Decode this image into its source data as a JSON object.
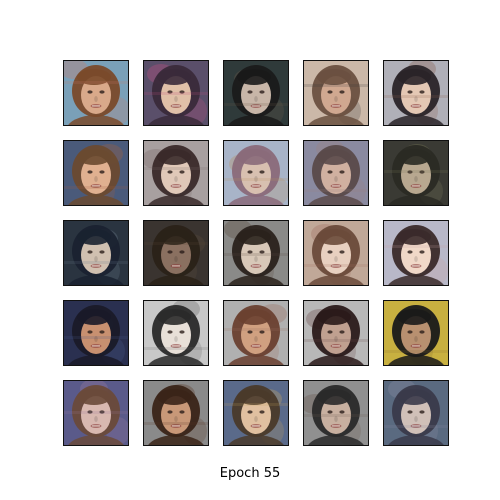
{
  "figure": {
    "caption": "Epoch 55",
    "rows": 5,
    "cols": 5,
    "images": [
      {
        "bg": "#7aa0b8",
        "hair": "#7a4a2a",
        "skin": "#d9a98a",
        "accent": "#c97a6a"
      },
      {
        "bg": "#5a4f6a",
        "hair": "#3a2a3a",
        "skin": "#e0c0a8",
        "accent": "#c05080"
      },
      {
        "bg": "#2f3a3a",
        "hair": "#1a1a1a",
        "skin": "#c8b6a8",
        "accent": "#6a5a4a"
      },
      {
        "bg": "#cbb8a8",
        "hair": "#6a5040",
        "skin": "#d0a890",
        "accent": "#3a3a3a"
      },
      {
        "bg": "#b0b0b8",
        "hair": "#2a2428",
        "skin": "#e4c8b4",
        "accent": "#8a6050"
      },
      {
        "bg": "#4a5a7a",
        "hair": "#6a4a30",
        "skin": "#e0b090",
        "accent": "#a06040"
      },
      {
        "bg": "#a8a0a0",
        "hair": "#3a2a2a",
        "skin": "#e0c8b8",
        "accent": "#7a6a6a"
      },
      {
        "bg": "#a8b4c8",
        "hair": "#8a6a7a",
        "skin": "#d8c0b0",
        "accent": "#b89060"
      },
      {
        "bg": "#8a8aa0",
        "hair": "#5a4a4a",
        "skin": "#d0b0a0",
        "accent": "#9a8080"
      },
      {
        "bg": "#3a3a34",
        "hair": "#2a2a24",
        "skin": "#b8a890",
        "accent": "#7a7a5a"
      },
      {
        "bg": "#2a3440",
        "hair": "#1a2230",
        "skin": "#d0c0b0",
        "accent": "#6a7a8a"
      },
      {
        "bg": "#3a3430",
        "hair": "#2a2218",
        "skin": "#8a7060",
        "accent": "#5a4a3a"
      },
      {
        "bg": "#8a8a88",
        "hair": "#2a221c",
        "skin": "#d8c8b8",
        "accent": "#5a4a40"
      },
      {
        "bg": "#c0a898",
        "hair": "#6a4a3a",
        "skin": "#e8d0c0",
        "accent": "#a07060"
      },
      {
        "bg": "#b8b8c8",
        "hair": "#3a2a2a",
        "skin": "#f0d8c8",
        "accent": "#c8a0a0"
      },
      {
        "bg": "#2a3050",
        "hair": "#1a1a28",
        "skin": "#c89070",
        "accent": "#4a5a8a"
      },
      {
        "bg": "#c8c8c8",
        "hair": "#2a2a2a",
        "skin": "#e8e0d8",
        "accent": "#6a6a6a"
      },
      {
        "bg": "#b0b0b0",
        "hair": "#6a4030",
        "skin": "#d0a080",
        "accent": "#9a7060"
      },
      {
        "bg": "#b8b8b8",
        "hair": "#2a1a1a",
        "skin": "#c0a090",
        "accent": "#6a4a4a"
      },
      {
        "bg": "#c8b040",
        "hair": "#1a1a1a",
        "skin": "#b89070",
        "accent": "#8a7030"
      },
      {
        "bg": "#5a5a8a",
        "hair": "#6a4a3a",
        "skin": "#d8b8b0",
        "accent": "#9a7a9a"
      },
      {
        "bg": "#8a8a8a",
        "hair": "#3a2418",
        "skin": "#c89878",
        "accent": "#5a3a28"
      },
      {
        "bg": "#5a6a8a",
        "hair": "#4a3a2a",
        "skin": "#e0c0a0",
        "accent": "#c0a060"
      },
      {
        "bg": "#909090",
        "hair": "#2a2a2a",
        "skin": "#c8b0a0",
        "accent": "#6a5a50"
      },
      {
        "bg": "#5a6a80",
        "hair": "#3a3a4a",
        "skin": "#d0c0b8",
        "accent": "#8a8aa0"
      }
    ]
  }
}
